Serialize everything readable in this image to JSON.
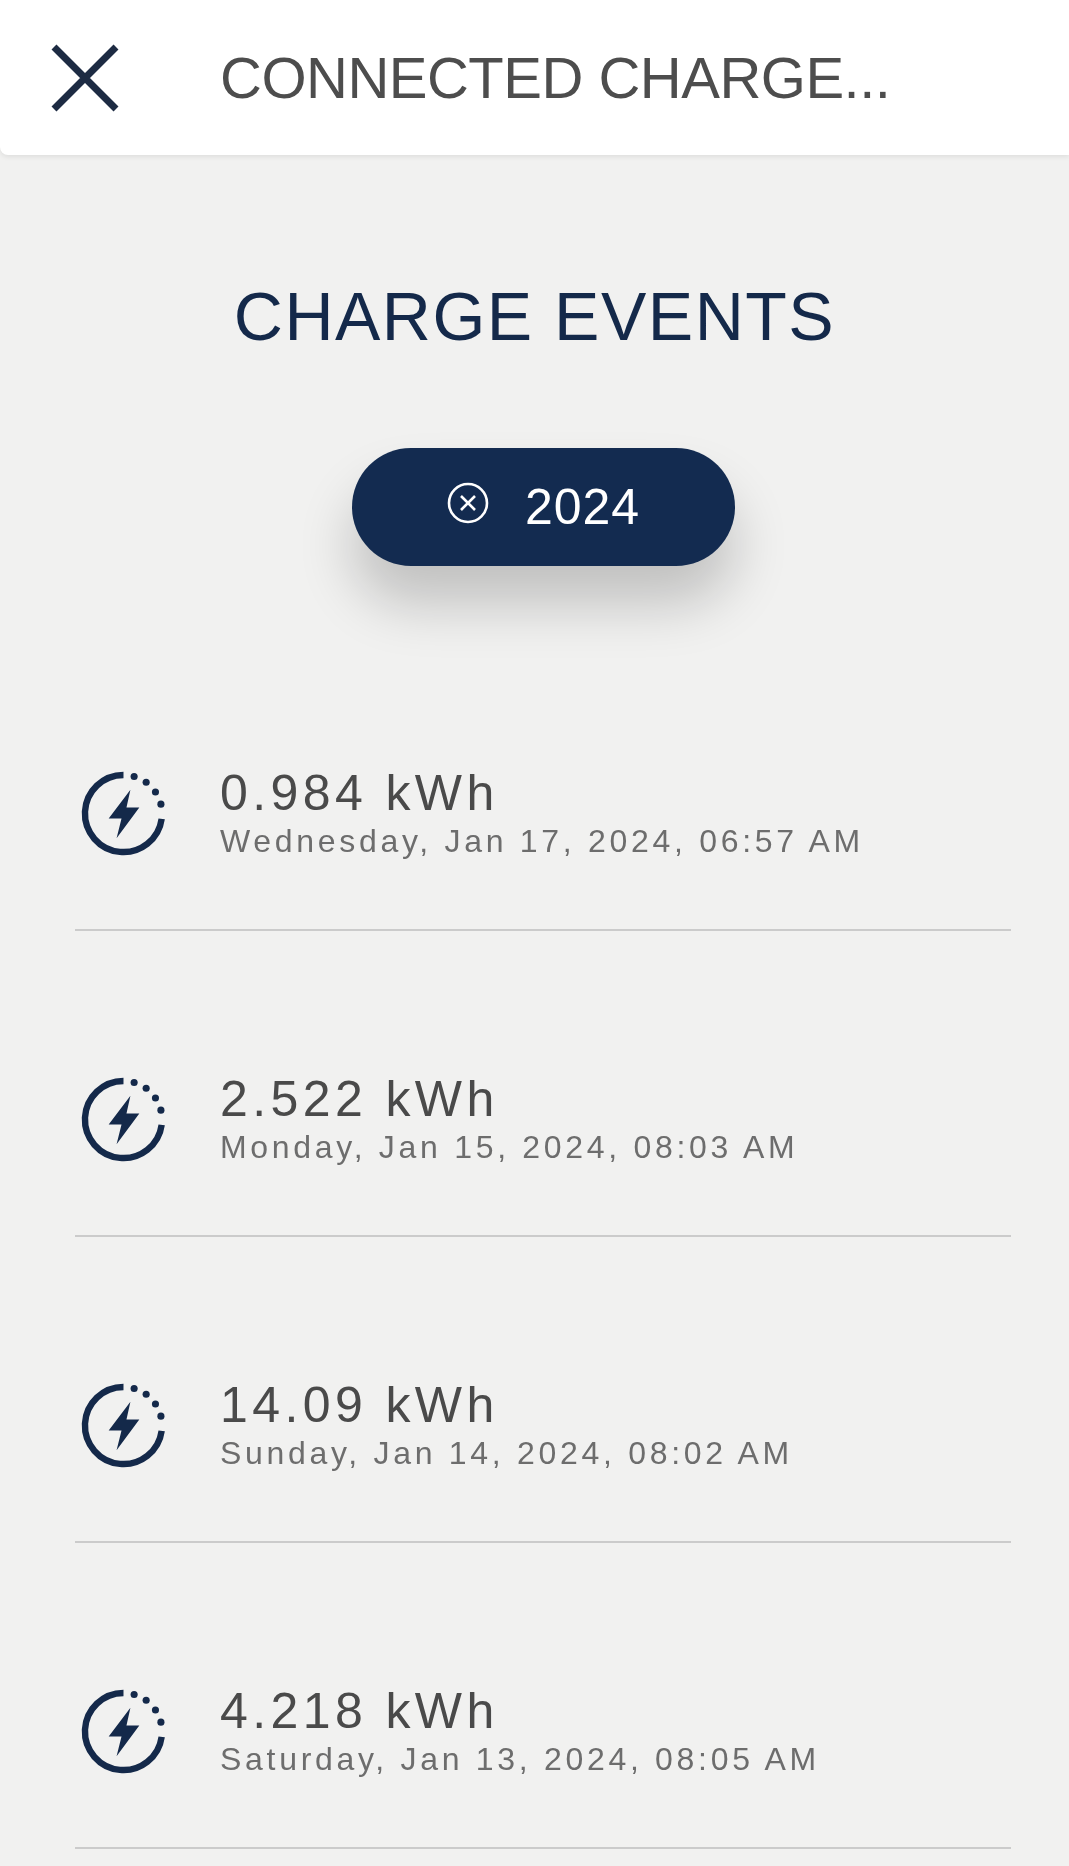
{
  "header": {
    "title": "CONNECTED CHARGE..."
  },
  "section": {
    "title": "CHARGE EVENTS"
  },
  "filter_chip": {
    "label": "2024"
  },
  "events": [
    {
      "energy": "0.984 kWh",
      "date": "Wednesday, Jan 17, 2024, 06:57 AM"
    },
    {
      "energy": "2.522 kWh",
      "date": "Monday, Jan 15, 2024, 08:03 AM"
    },
    {
      "energy": "14.09 kWh",
      "date": "Sunday, Jan 14, 2024, 08:02 AM"
    },
    {
      "energy": "4.218 kWh",
      "date": "Saturday, Jan 13, 2024, 08:05 AM"
    }
  ]
}
